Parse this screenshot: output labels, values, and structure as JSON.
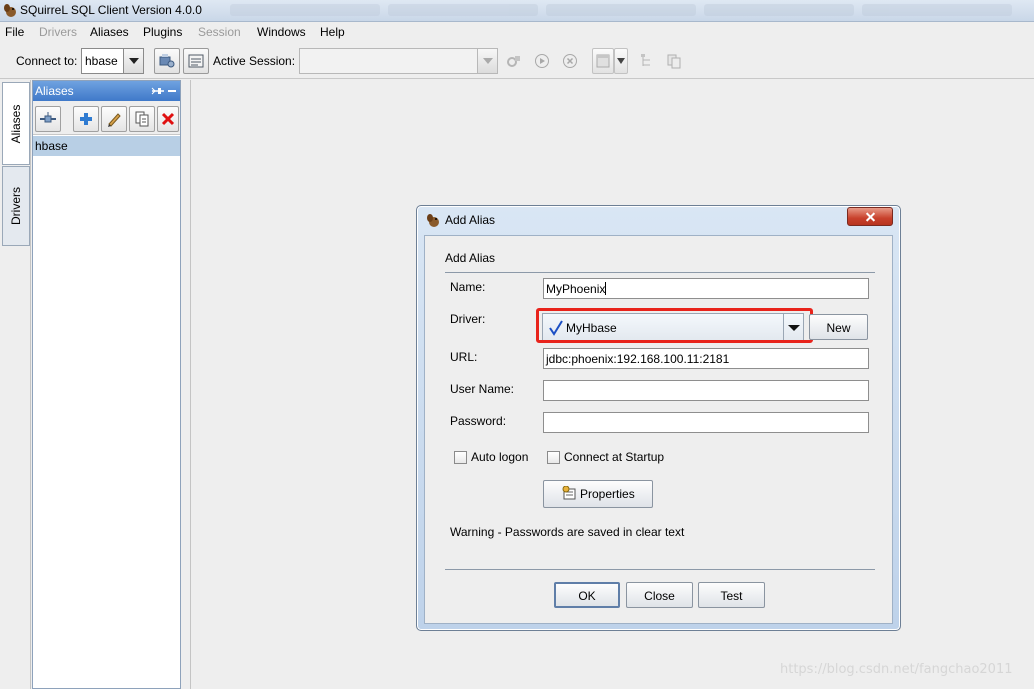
{
  "window": {
    "title": "SQuirreL SQL Client Version 4.0.0"
  },
  "menu": [
    {
      "label": "File",
      "enabled": true
    },
    {
      "label": "Drivers",
      "enabled": false
    },
    {
      "label": "Aliases",
      "enabled": true
    },
    {
      "label": "Plugins",
      "enabled": true
    },
    {
      "label": "Session",
      "enabled": false
    },
    {
      "label": "Windows",
      "enabled": true
    },
    {
      "label": "Help",
      "enabled": true
    }
  ],
  "toolbar": {
    "connect_label": "Connect to:",
    "connect_value": "hbase",
    "active_session_label": "Active Session:",
    "active_session_value": ""
  },
  "side_tabs": {
    "aliases": "Aliases",
    "drivers": "Drivers"
  },
  "aliases_panel": {
    "title": "Aliases",
    "items": [
      "hbase"
    ]
  },
  "dialog": {
    "title": "Add Alias",
    "heading": "Add Alias",
    "name_label": "Name:",
    "name_value": "MyPhoenix",
    "driver_label": "Driver:",
    "driver_value": "MyHbase",
    "new_button": "New",
    "url_label": "URL:",
    "url_value": "jdbc:phoenix:192.168.100.11:2181",
    "username_label": "User Name:",
    "username_value": "",
    "password_label": "Password:",
    "password_value": "",
    "auto_logon_label": "Auto logon",
    "auto_logon_checked": false,
    "connect_startup_label": "Connect at Startup",
    "connect_startup_checked": false,
    "properties_button": "Properties",
    "warning": "Warning - Passwords are saved in clear text",
    "ok_button": "OK",
    "close_button": "Close",
    "test_button": "Test"
  },
  "watermark": "https://blog.csdn.net/fangchao2011",
  "colors": {
    "highlight": "#e8231b",
    "panel_header": "#3f79c9",
    "selection": "#b8cfe5",
    "check": "#1b4fc4"
  },
  "icons": [
    "squirrel-icon",
    "connect-icon",
    "sql-icon",
    "run-icon",
    "stop-icon",
    "pin-icon",
    "add-icon",
    "edit-icon",
    "copy-icon",
    "delete-icon",
    "checkmark-icon",
    "properties-icon"
  ]
}
